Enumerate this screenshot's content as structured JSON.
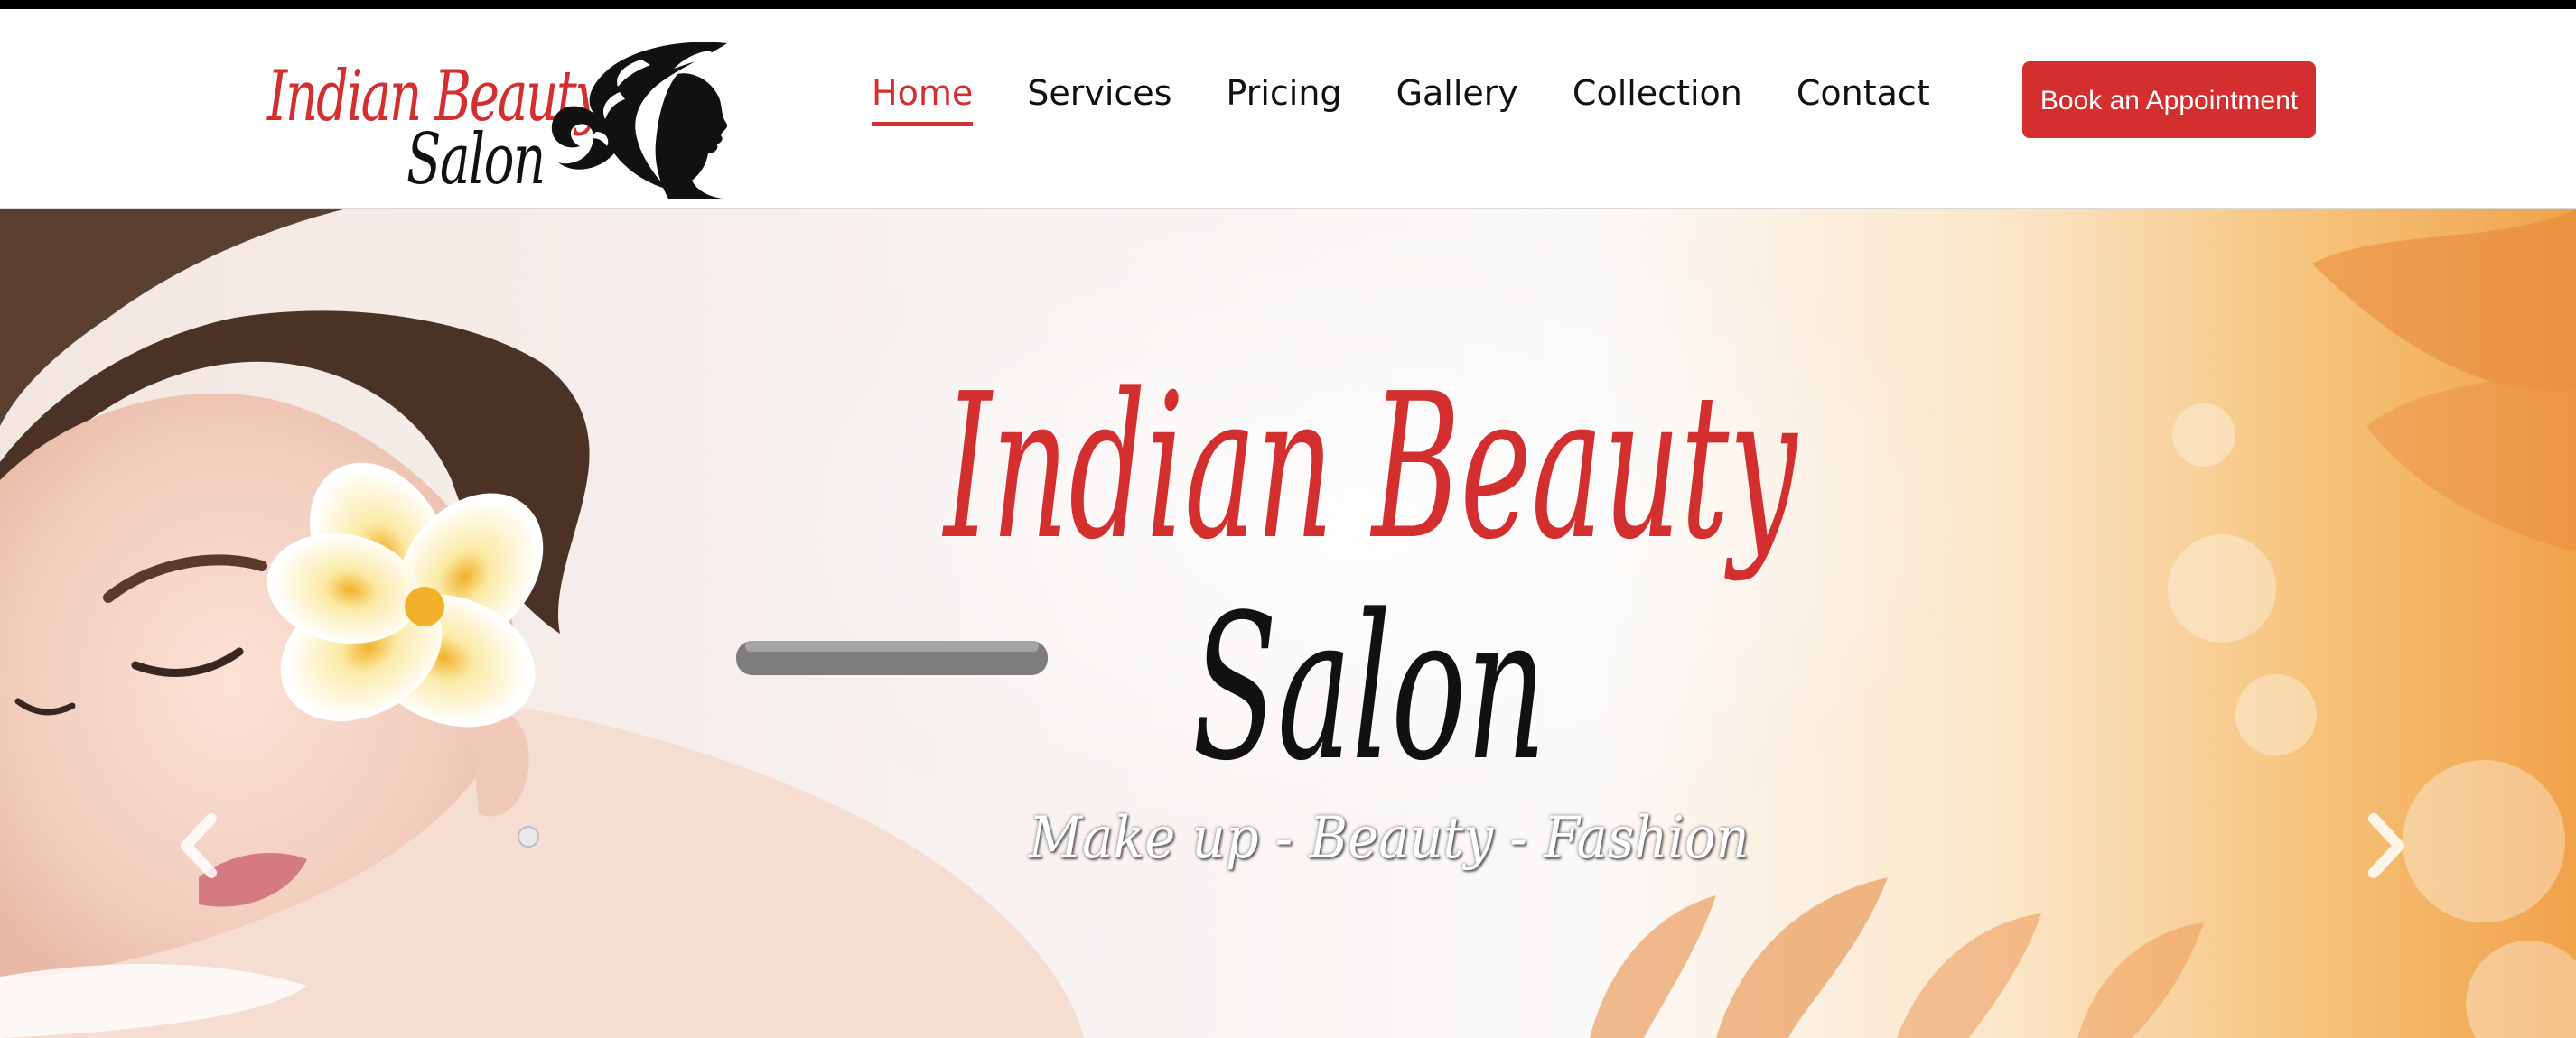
{
  "brand": {
    "logo_line1": "Indian Beauty",
    "logo_line2": "Salon"
  },
  "nav": {
    "items": [
      {
        "label": "Home",
        "active": true
      },
      {
        "label": "Services",
        "active": false
      },
      {
        "label": "Pricing",
        "active": false
      },
      {
        "label": "Gallery",
        "active": false
      },
      {
        "label": "Collection",
        "active": false
      },
      {
        "label": "Contact",
        "active": false
      }
    ]
  },
  "cta": {
    "label": "Book an Appointment"
  },
  "hero": {
    "title_line1": "Indian Beauty",
    "title_line2": "Salon",
    "tagline": "Make up - Beauty - Fashion",
    "prev_icon": "chevron-left-icon",
    "next_icon": "chevron-right-icon"
  },
  "colors": {
    "accent": "#d32f2f",
    "text": "#111111",
    "top_strip": "#000000"
  }
}
